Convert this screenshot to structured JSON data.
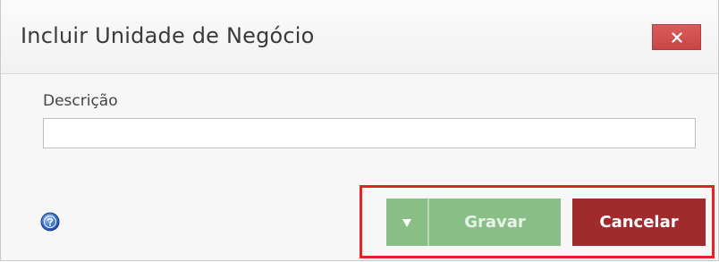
{
  "dialog": {
    "title": "Incluir Unidade de Negócio",
    "close_icon": "close-icon"
  },
  "form": {
    "descricao_label": "Descrição",
    "descricao_value": ""
  },
  "footer": {
    "help_icon": "help-icon",
    "dropdown_icon": "triangle-down-icon",
    "save_label": "Gravar",
    "cancel_label": "Cancelar"
  },
  "colors": {
    "close_button": "#d24f4f",
    "save_button": "#89be86",
    "cancel_button": "#a12a2c",
    "highlight": "#e32424"
  }
}
